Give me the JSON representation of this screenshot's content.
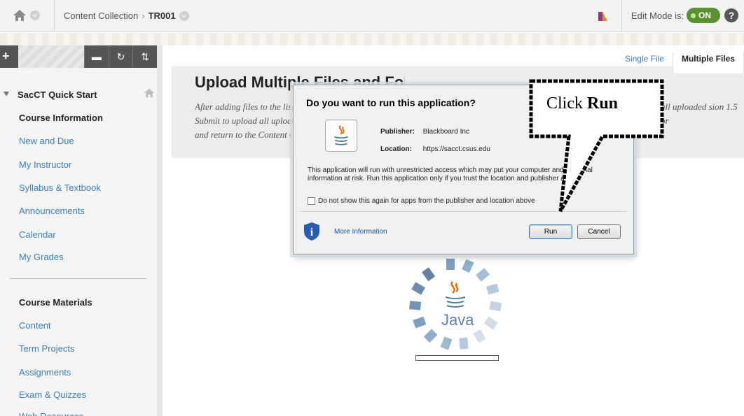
{
  "topbar": {
    "breadcrumb": [
      "Content Collection",
      "TR001"
    ],
    "breadcrumb_sep": "›",
    "edit_mode_label": "Edit Mode is:",
    "edit_mode_value": "ON",
    "help": "?"
  },
  "sidebar": {
    "toolbar": {
      "add": "+",
      "display": "▬",
      "refresh": "↻",
      "sort": "⇅"
    },
    "course_title": "SacCT Quick Start",
    "sections": [
      {
        "heading": "Course Information",
        "items": [
          "New and Due",
          "My Instructor",
          "Syllabus & Textbook",
          "Announcements",
          "Calendar",
          "My Grades"
        ]
      },
      {
        "heading": "Course Materials",
        "items": [
          "Content",
          "Term Projects",
          "Assignments",
          "Exam & Quizzes",
          "Web Resources"
        ]
      }
    ]
  },
  "main": {
    "tabs": [
      "Single File",
      "Multiple Files"
    ],
    "active_tab": "Multiple Files",
    "title": "Upload Multiple Files and Folders",
    "description_left": "After adding files to the list, click Submit to upload all uploaded files and return to the Content Collection. Java version 1.5 or later. If the plugin is not installed,",
    "description_right": "all uploaded sion 1.5 or",
    "java_label": "Java"
  },
  "dialog": {
    "title": "Do you want to run this application?",
    "publisher_label": "Publisher:",
    "publisher_value": "Blackboard Inc",
    "location_label": "Location:",
    "location_value": "https://sacct.csus.edu",
    "warning": "This application will run with unrestricted access which may put your computer and personal information at risk. Run this application only if you trust the location and publisher above.",
    "checkbox_label": "Do not show this again for apps from the publisher and location above",
    "more_info": "More Information",
    "run_label": "Run",
    "cancel_label": "Cancel"
  },
  "callout": {
    "prefix": "Click",
    "emphasis": "Run"
  },
  "colors": {
    "link": "#3a7fb8",
    "toggle_on": "#5a8f32",
    "dialog_bg": "#f0f0f0"
  }
}
